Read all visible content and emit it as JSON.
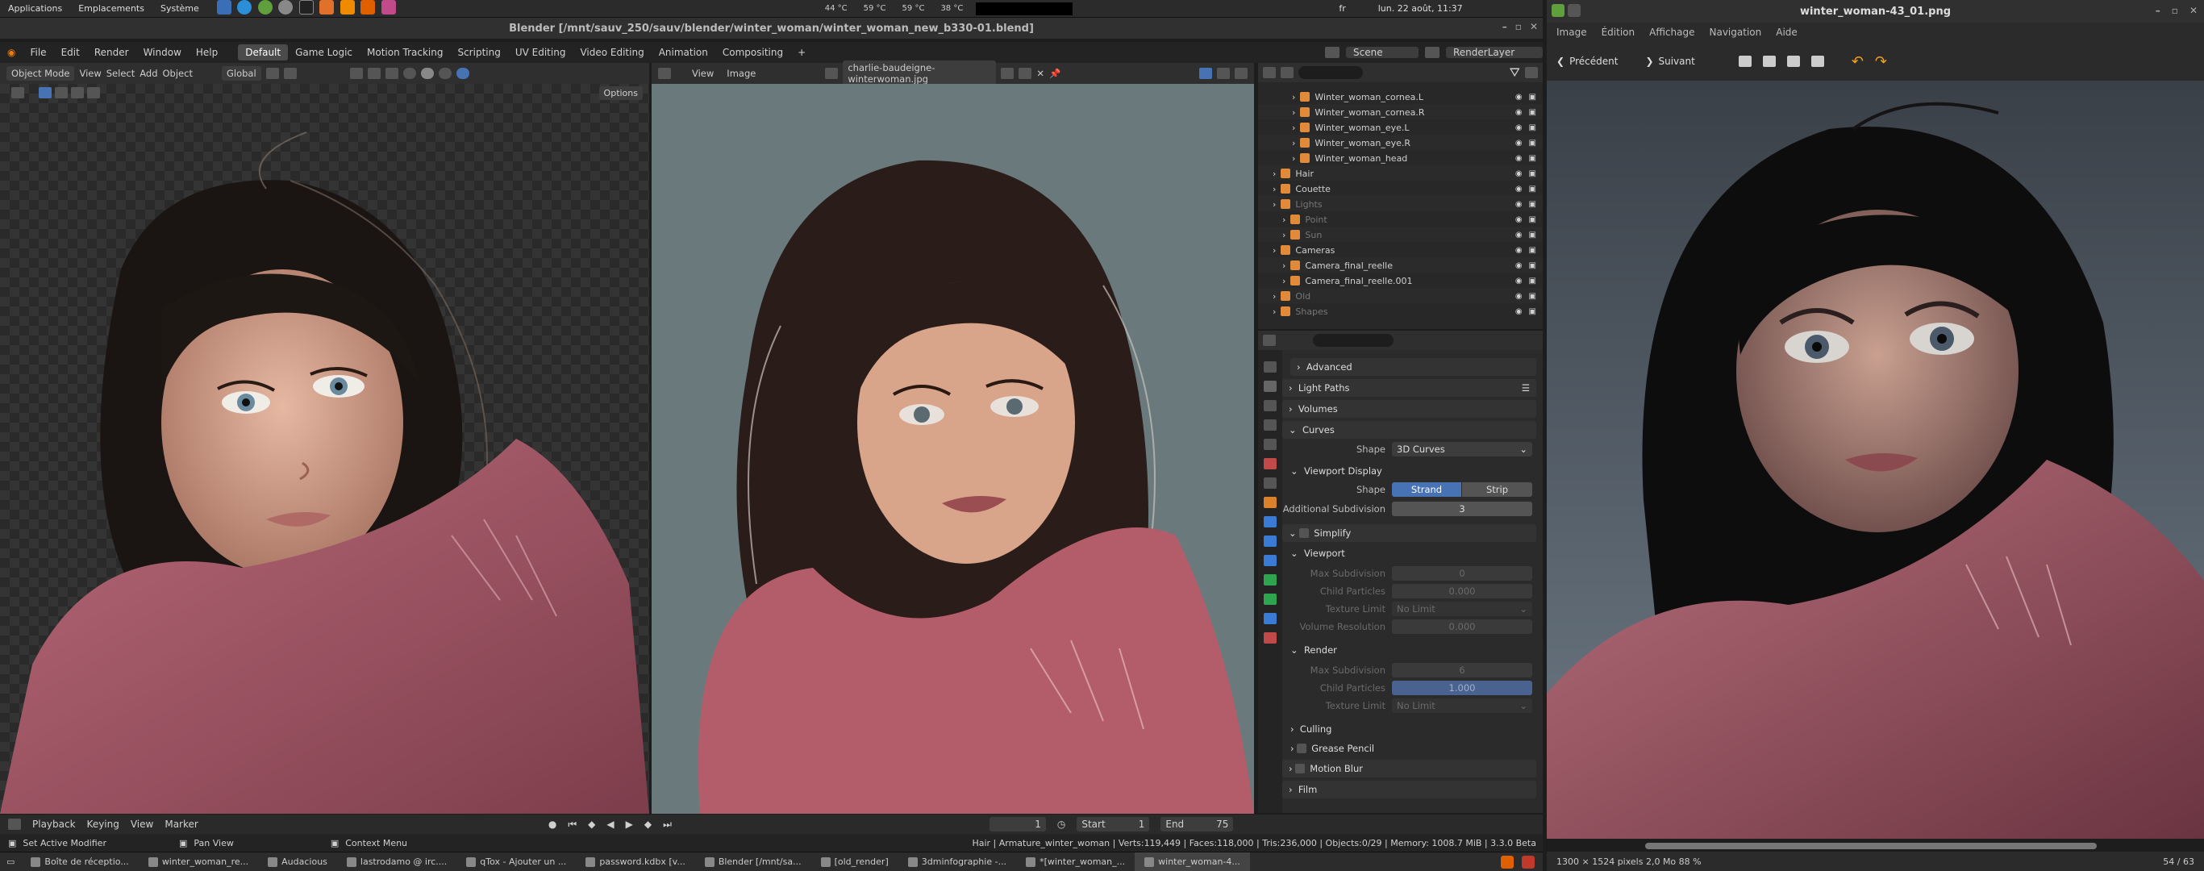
{
  "system_panel": {
    "menus": [
      "Applications",
      "Emplacements",
      "Système"
    ],
    "temps": [
      "44 °C",
      "59 °C",
      "59 °C",
      "38 °C"
    ],
    "keyboard": "fr",
    "clock": "lun. 22 août, 11:37"
  },
  "blender": {
    "window_title": "Blender [/mnt/sauv_250/sauv/blender/winter_woman/winter_woman_new_b330-01.blend]",
    "menus": [
      "File",
      "Edit",
      "Render",
      "Window",
      "Help"
    ],
    "workspaces": [
      "Default",
      "Game Logic",
      "Motion Tracking",
      "Scripting",
      "UV Editing",
      "Video Editing",
      "Animation",
      "Compositing"
    ],
    "active_workspace": "Default",
    "scene": "Scene",
    "render_layer": "RenderLayer",
    "viewport3d": {
      "mode": "Object Mode",
      "menus": [
        "View",
        "Select",
        "Add",
        "Object"
      ],
      "transform": "Global",
      "options": "Options"
    },
    "image_editor": {
      "menus": [
        "View",
        "Image"
      ],
      "image_name": "charlie-baudeigne-winterwoman.jpg"
    },
    "outliner": [
      {
        "name": "Winter_woman_cornea.L",
        "indent": 3
      },
      {
        "name": "Winter_woman_cornea.R",
        "indent": 3
      },
      {
        "name": "Winter_woman_eye.L",
        "indent": 3
      },
      {
        "name": "Winter_woman_eye.R",
        "indent": 3
      },
      {
        "name": "Winter_woman_head",
        "indent": 3
      },
      {
        "name": "Hair",
        "indent": 1
      },
      {
        "name": "Couette",
        "indent": 1
      },
      {
        "name": "Lights",
        "indent": 1
      },
      {
        "name": "Point",
        "indent": 2
      },
      {
        "name": "Sun",
        "indent": 2
      },
      {
        "name": "Cameras",
        "indent": 1
      },
      {
        "name": "Camera_final_reelle",
        "indent": 2
      },
      {
        "name": "Camera_final_reelle.001",
        "indent": 2
      },
      {
        "name": "Old",
        "indent": 1
      },
      {
        "name": "Shapes",
        "indent": 1
      }
    ],
    "properties": {
      "advanced": "Advanced",
      "light_paths": "Light Paths",
      "volumes": "Volumes",
      "curves": "Curves",
      "shape_label": "Shape",
      "shape_value": "3D Curves",
      "viewport_display": "Viewport Display",
      "shape2_label": "Shape",
      "strand": "Strand",
      "strip": "Strip",
      "additional_subdivision_label": "Additional Subdivision",
      "additional_subdivision_value": "3",
      "simplify": "Simplify",
      "viewport": "Viewport",
      "max_subdivision_label": "Max Subdivision",
      "max_subdivision_value": "0",
      "child_particles_label": "Child Particles",
      "child_particles_value": "0.000",
      "texture_limit_label": "Texture Limit",
      "texture_limit_value": "No Limit",
      "volume_resolution_label": "Volume Resolution",
      "volume_resolution_value": "0.000",
      "render": "Render",
      "render_max_subdivision_label": "Max Subdivision",
      "render_max_subdivision_value": "6",
      "render_child_particles_label": "Child Particles",
      "render_child_particles_value": "1.000",
      "render_texture_limit_label": "Texture Limit",
      "render_texture_limit_value": "No Limit",
      "culling": "Culling",
      "grease_pencil": "Grease Pencil",
      "motion_blur": "Motion Blur",
      "film": "Film"
    },
    "timeline": {
      "menus": [
        "Playback",
        "Keying",
        "View",
        "Marker"
      ],
      "current_frame": "1",
      "start_label": "Start",
      "start_value": "1",
      "end_label": "End",
      "end_value": "75"
    },
    "status": {
      "left": "Set Active Modifier",
      "middle": "Pan View",
      "context": "Context Menu",
      "stats": "Hair | Armature_winter_woman | Verts:119,449 | Faces:118,000 | Tris:236,000 | Objects:0/29 | Memory: 1008.7 MiB | 3.3.0 Beta"
    }
  },
  "taskbar": [
    {
      "label": "Boîte de réceptio...",
      "active": false
    },
    {
      "label": "winter_woman_re...",
      "active": false
    },
    {
      "label": "Audacious",
      "active": false
    },
    {
      "label": "lastrodamo @ irc....",
      "active": false
    },
    {
      "label": "qTox - Ajouter un ...",
      "active": false
    },
    {
      "label": "password.kdbx [v...",
      "active": false
    },
    {
      "label": "Blender [/mnt/sa...",
      "active": false
    },
    {
      "label": "[old_render]",
      "active": false
    },
    {
      "label": "3dminfographie -...",
      "active": false
    },
    {
      "label": "*[winter_woman_...",
      "active": false
    },
    {
      "label": "winter_woman-4...",
      "active": true
    }
  ],
  "viewer": {
    "title": "winter_woman-43_01.png",
    "menus": [
      "Image",
      "Édition",
      "Affichage",
      "Navigation",
      "Aide"
    ],
    "prev": "Précédent",
    "next": "Suivant",
    "info": "1300 × 1524 pixels  2,0 Mo    88 %",
    "counter": "54 / 63"
  }
}
